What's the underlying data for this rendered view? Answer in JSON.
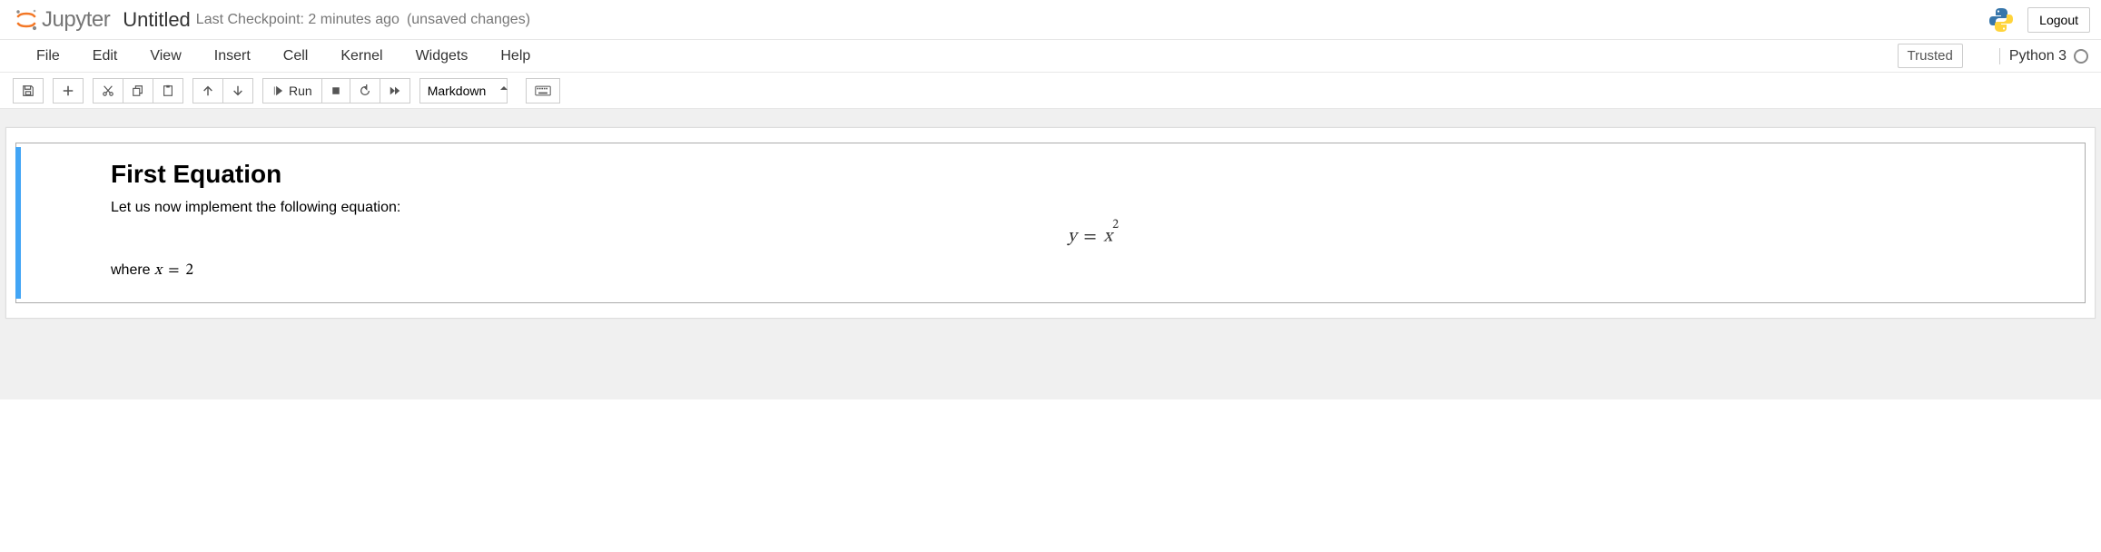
{
  "header": {
    "brand": "Jupyter",
    "notebook_name": "Untitled",
    "checkpoint_status": "Last Checkpoint: 2 minutes ago",
    "autosave_status": "(unsaved changes)",
    "logout_label": "Logout"
  },
  "menubar": {
    "items": [
      "File",
      "Edit",
      "View",
      "Insert",
      "Cell",
      "Kernel",
      "Widgets",
      "Help"
    ],
    "trusted_label": "Trusted",
    "kernel_name": "Python 3"
  },
  "toolbar": {
    "run_label": "Run",
    "celltype_selected": "Markdown"
  },
  "cell": {
    "heading": "First Equation",
    "intro": "Let us now implement the following equation:",
    "equation_y": "y",
    "equation_eq": "=",
    "equation_x": "x",
    "equation_exp": "2",
    "where_text": "where ",
    "where_var": "x",
    "where_eq": "=",
    "where_val": "2"
  }
}
